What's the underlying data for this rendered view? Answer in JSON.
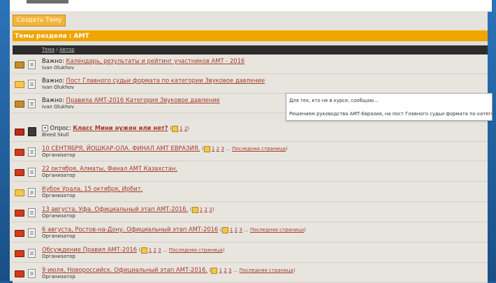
{
  "toolbar": {
    "create_topic_label": "Создать Тему"
  },
  "section": {
    "title": "Темы раздела : АМТ",
    "column_topic": "Тема",
    "column_sep": " / ",
    "column_author": "Автор"
  },
  "topics": [
    {
      "prefix": "Важно: ",
      "title": "Календарь, результаты и рейтинг участников АМТ - 2016",
      "author": "Ivan Olukhov"
    },
    {
      "prefix": "Важно: ",
      "title": "Пост Главного судьи формата по категории Звуковое давление",
      "author": "Ivan Olukhov"
    },
    {
      "prefix": "Важно: ",
      "title": "Правила АМТ-2016 Категория Звуковое давление",
      "author": "Ivan Olukhov"
    },
    {
      "prefix": "Опрос: ",
      "title": "Класс Мини нужен или нет?",
      "pages": [
        "1",
        "2"
      ],
      "author": "Bleed Skull"
    },
    {
      "title": "10 СЕНТЯБРЯ, ЙОШКАР-ОЛА. ФИНАЛ АМТ ЕВРАЗИЯ.",
      "pages": [
        "1",
        "2",
        "3"
      ],
      "last_page": "Последняя страница",
      "author": "Организатор"
    },
    {
      "title": "22 октября, Алматы, Финал АМТ Казахстан.",
      "author": "Организатор"
    },
    {
      "title": "Кубок Урала, 15 октября, Ирбит.",
      "author": "Организатор"
    },
    {
      "title": "13 августа, Уфа. Официальный этап АМТ-2016.",
      "pages": [
        "1",
        "2",
        "3"
      ],
      "author": "Организатор"
    },
    {
      "title": "6 августа, Ростов-на-Дону. Официальный этап АМТ-2016",
      "pages": [
        "1",
        "2",
        "3"
      ],
      "last_page": "Последняя страница",
      "author": "Организатор"
    },
    {
      "title": "Обсуждение Правил АМТ-2016",
      "pages": [
        "1",
        "2",
        "3"
      ],
      "last_page": "Последняя страница",
      "author": "Организатор"
    },
    {
      "title": "9 июля, Новороссийск. Официальный этап АМТ-2016.",
      "pages": [
        "1",
        "2",
        "3"
      ],
      "last_page": "Последняя страница",
      "author": "Организатор"
    }
  ],
  "pagination": {
    "ellipsis": "...",
    "open": "(",
    "close": ")"
  },
  "tooltip": {
    "line1": "Для тех, кто не в курсе, сообщаю...",
    "line2": "Решением руководства АМТ-Евразия, на пост Главного судьи формата по категории"
  },
  "icons": {
    "row_status": [
      "envelope-icon",
      "envelope-icon",
      "envelope-icon",
      "poll-icon",
      "envelope-hot-icon",
      "envelope-hot-icon",
      "envelope-icon",
      "envelope-hot-icon",
      "envelope-hot-icon",
      "envelope-hot-icon",
      "envelope-hot-icon"
    ],
    "row_type": "topic-icon",
    "poll_arrow": "chevron-down-icon"
  },
  "colors": {
    "section_header": "#f0a400",
    "link": "#a53b2a",
    "button": "#f4b43c"
  }
}
